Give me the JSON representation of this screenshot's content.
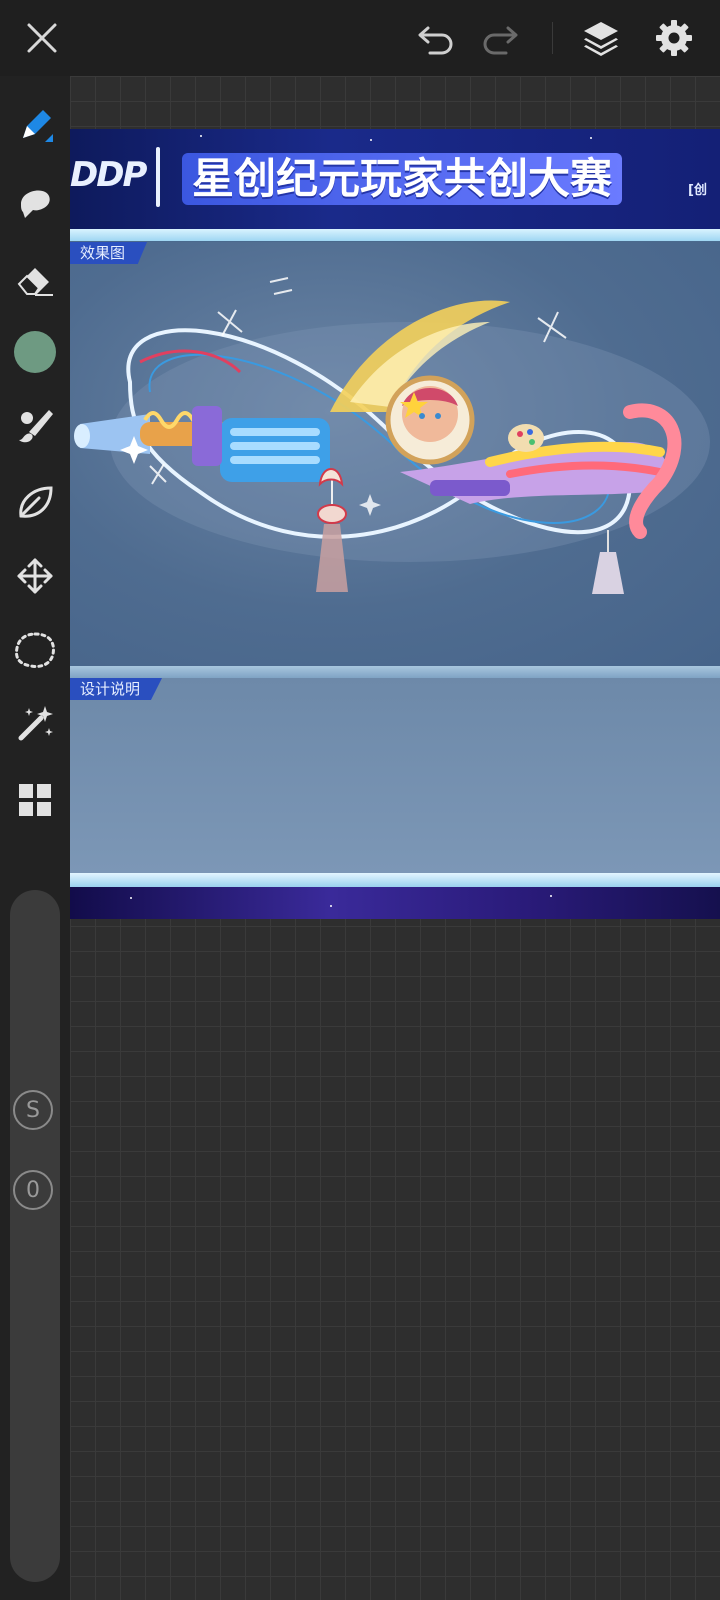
{
  "toolbar": {
    "close_icon": "close-icon",
    "undo_icon": "undo-icon",
    "redo_icon": "redo-icon",
    "layers_icon": "layers-icon",
    "settings_icon": "settings-icon"
  },
  "tools": {
    "items": [
      "brush-icon",
      "smudge-icon",
      "eraser-icon",
      "color-swatch",
      "paintbrush-icon",
      "leaf-icon",
      "transform-icon",
      "lasso-icon",
      "magic-wand-icon",
      "grid-icon"
    ],
    "active_color": "#6e9a82",
    "accent": "#1e88e5"
  },
  "sliders": {
    "size_label": "S",
    "opacity_label": "0"
  },
  "artwork": {
    "banner_logo": "DDP",
    "banner_title": "星创纪元玩家共创大赛",
    "banner_tag": "[创",
    "section1_label": "效果图",
    "section2_label": "设计说明"
  }
}
